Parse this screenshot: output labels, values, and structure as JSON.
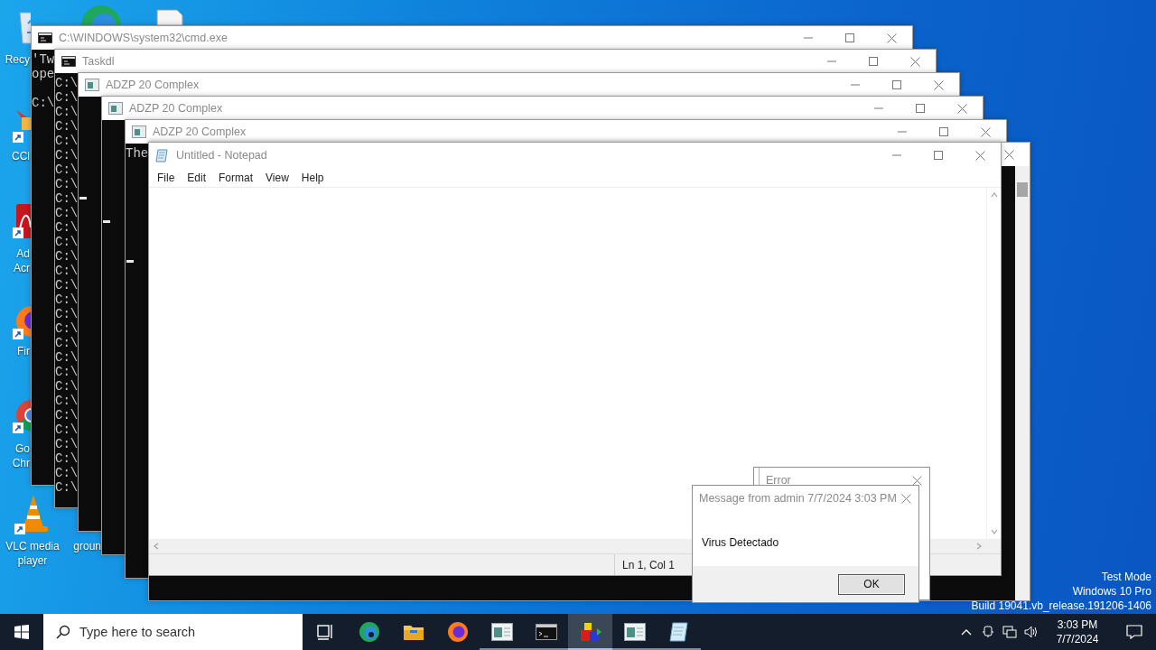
{
  "desktop_icons": [
    {
      "kind": "bin",
      "lines": [
        "Recy"
      ],
      "shortcut": false
    },
    {
      "kind": "cleaner",
      "lines": [
        "CCl"
      ],
      "shortcut": true
    },
    {
      "kind": "pdf",
      "lines": [
        "Ad",
        "Acr"
      ],
      "shortcut": true
    },
    {
      "kind": "firefox",
      "lines": [
        "Fir"
      ],
      "shortcut": true
    },
    {
      "kind": "chrome",
      "lines": [
        "Go",
        "Chr"
      ],
      "shortcut": true
    },
    {
      "kind": "vlc",
      "lines": [
        "VLC media",
        "player"
      ],
      "shortcut": true
    },
    {
      "lines": [
        "groun"
      ]
    },
    {
      "kind": "edge"
    },
    {
      "kind": "file"
    }
  ],
  "windows": [
    {
      "kind": "console",
      "title": "C:\\WINDOWS\\system32\\cmd.exe",
      "lines": [
        "'Tw",
        "ope"
      ],
      "prompt": "C:\\",
      "cursor": false
    },
    {
      "kind": "console",
      "title": "Taskdl",
      "lines": [
        "C:\\",
        "C:\\",
        "C:\\",
        "C:\\",
        "C:\\",
        "C:\\",
        "C:\\",
        "C:\\",
        "C:\\",
        "C:\\",
        "C:\\",
        "C:\\",
        "C:\\",
        "C:\\",
        "C:\\",
        "C:\\",
        "C:\\",
        "C:\\",
        "C:\\",
        "C:\\",
        "C:\\",
        "C:\\",
        "C:\\",
        "C:\\",
        "C:\\",
        "C:\\",
        "C:\\",
        "C:\\",
        "C:\\"
      ],
      "cursor": false
    },
    {
      "kind": "console",
      "title": "ADZP 20 Complex",
      "cursor": true
    },
    {
      "kind": "console",
      "title": "ADZP 20 Complex",
      "cursor": true
    },
    {
      "kind": "console",
      "title": "ADZP 20 Complex",
      "lines": [
        "The"
      ],
      "cursor": true
    },
    {
      "kind": "console"
    },
    {
      "kind": "notepad",
      "title": "Untitled - Notepad",
      "menu": [
        "File",
        "Edit",
        "Format",
        "View",
        "Help"
      ],
      "status": "Ln 1, Col 1"
    }
  ],
  "dialogs": [
    {
      "kind": "error",
      "title": "Error"
    },
    {
      "kind": "message",
      "title": "Message from admin 7/7/2024 3:03 PM",
      "text": "Virus Detectado",
      "button": "OK"
    }
  ],
  "watermark": [
    "Test Mode",
    "Windows 10 Pro",
    "Build 19041.vb_release.191206-1406"
  ],
  "taskbar": {
    "search": {
      "placeholder": "Type here to search"
    },
    "apps": [
      {
        "kind": "taskview",
        "running": false,
        "selected": false
      },
      {
        "kind": "edge",
        "running": false,
        "selected": false
      },
      {
        "kind": "explorer",
        "running": false,
        "selected": false
      },
      {
        "kind": "firefox",
        "running": false,
        "selected": false
      },
      {
        "kind": "window",
        "running": true,
        "selected": false
      },
      {
        "kind": "cmd",
        "running": true,
        "selected": false
      },
      {
        "kind": "blocks",
        "running": true,
        "selected": true
      },
      {
        "kind": "window",
        "running": true,
        "selected": false
      },
      {
        "kind": "notepad",
        "running": true,
        "selected": false
      }
    ],
    "time": "3:03 PM",
    "date": "7/7/2024"
  }
}
